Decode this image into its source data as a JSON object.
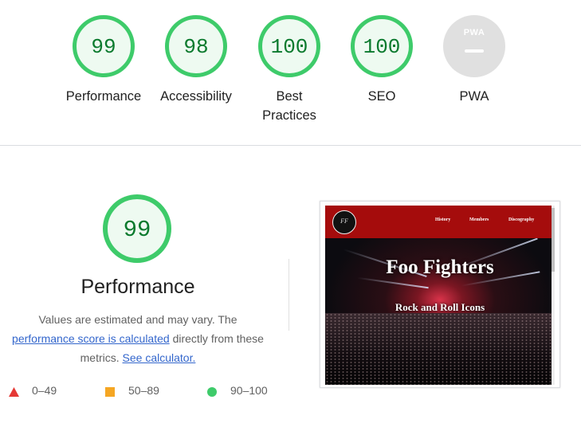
{
  "categories": [
    {
      "score": "99",
      "label": "Performance"
    },
    {
      "score": "98",
      "label": "Accessibility"
    },
    {
      "score": "100",
      "label": "Best Practices",
      "label_line1": "Best",
      "label_line2": "Practices"
    },
    {
      "score": "100",
      "label": "SEO"
    },
    {
      "score": "—",
      "label": "PWA",
      "badge": "PWA"
    }
  ],
  "performance": {
    "score": "99",
    "title": "Performance",
    "desc_part1": "Values are estimated and may vary. The",
    "desc_link1": "performance score is calculated",
    "desc_part2": "directly from these metrics.",
    "desc_link2": "See calculator."
  },
  "legend": [
    {
      "range": "0–49",
      "color": "#e53935",
      "shape": "triangle-icon"
    },
    {
      "range": "50–89",
      "color": "#f5a623",
      "shape": "square-icon"
    },
    {
      "range": "90–100",
      "color": "#3ecb6a",
      "shape": "circle-icon"
    }
  ],
  "screenshot": {
    "logo_text": "FF",
    "nav": [
      "History",
      "Members",
      "Discography"
    ],
    "title": "Foo Fighters",
    "subtitle": "Rock and Roll Icons"
  },
  "colors": {
    "pass": "#3ecb6a",
    "pass_text": "#0b7a2e",
    "link": "#3366cc",
    "nav_red": "#a50c0c"
  }
}
